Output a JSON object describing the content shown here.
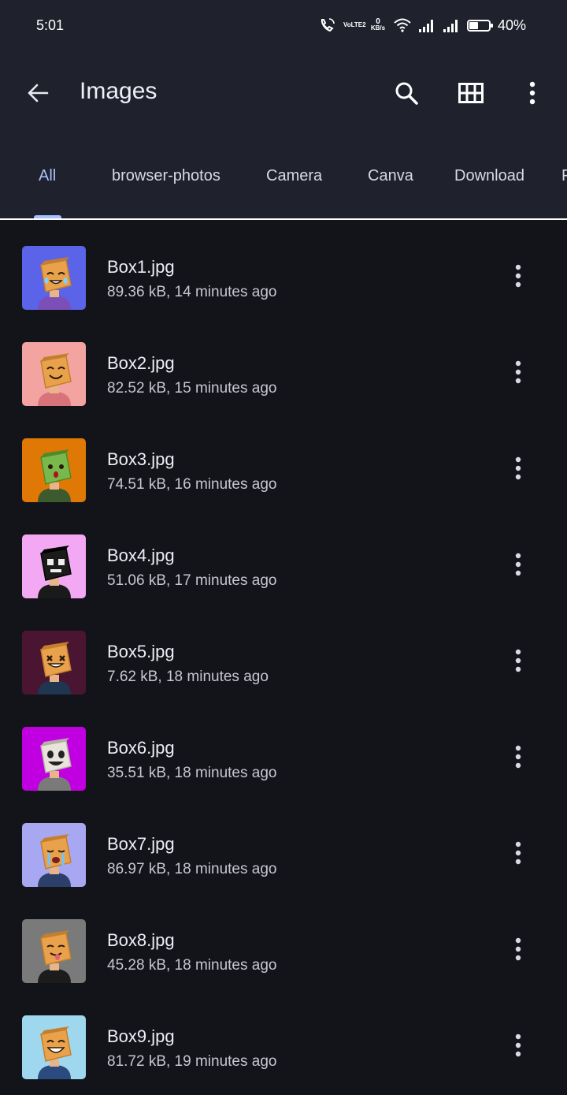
{
  "status_bar": {
    "time": "5:01",
    "volte_label": "VoLTE2",
    "net_speed_value": "0",
    "net_speed_unit": "KB/s",
    "battery": "40%"
  },
  "app_bar": {
    "title": "Images",
    "back_icon": "arrow-back-icon",
    "search_icon": "search-icon",
    "grid_icon": "grid-view-icon",
    "more_icon": "more-vert-icon"
  },
  "tabs": [
    {
      "label": "All",
      "active": true
    },
    {
      "label": "browser-photos",
      "active": false
    },
    {
      "label": "Camera",
      "active": false
    },
    {
      "label": "Canva",
      "active": false
    },
    {
      "label": "Download",
      "active": false
    },
    {
      "label": "F",
      "active": false
    }
  ],
  "files": [
    {
      "name": "Box1.jpg",
      "meta": "89.36 kB, 14 minutes ago",
      "bg": "#5b63e8",
      "face": "crying-laugh",
      "shirt": "#7b4fb8"
    },
    {
      "name": "Box2.jpg",
      "meta": "82.52 kB, 15 minutes ago",
      "bg": "#f4a4a0",
      "face": "smile",
      "shirt": "#d9737a"
    },
    {
      "name": "Box3.jpg",
      "meta": "74.51 kB, 16 minutes ago",
      "bg": "#e07806",
      "face": "cactus",
      "shirt": "#3d5a2e"
    },
    {
      "name": "Box4.jpg",
      "meta": "51.06 kB, 17 minutes ago",
      "bg": "#f2a8f2",
      "face": "skull",
      "shirt": "#1a1a1a"
    },
    {
      "name": "Box5.jpg",
      "meta": "7.62 kB, 18 minutes ago",
      "bg": "#4a1530",
      "face": "dead",
      "shirt": "#1f3550"
    },
    {
      "name": "Box6.jpg",
      "meta": "35.51 kB, 18 minutes ago",
      "bg": "#c000e0",
      "face": "ghoul",
      "shirt": "#7a7a7a"
    },
    {
      "name": "Box7.jpg",
      "meta": "86.97 kB, 18 minutes ago",
      "bg": "#a8a8f2",
      "face": "sob",
      "shirt": "#2b3f6a"
    },
    {
      "name": "Box8.jpg",
      "meta": "45.28 kB, 18 minutes ago",
      "bg": "#7a7a7a",
      "face": "tongue",
      "shirt": "#1c1c1c"
    },
    {
      "name": "Box9.jpg",
      "meta": "81.72 kB, 19 minutes ago",
      "bg": "#9fd8ee",
      "face": "laugh",
      "shirt": "#2a4a80"
    }
  ]
}
